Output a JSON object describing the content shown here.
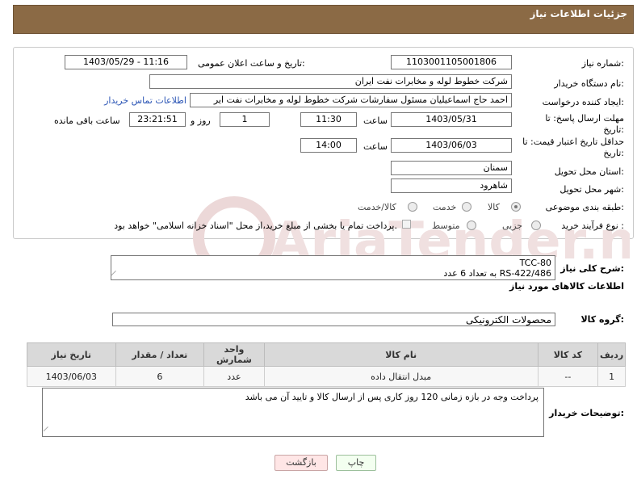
{
  "header": {
    "title": "جزئیات اطلاعات نیاز"
  },
  "form": {
    "need_number_label": "شماره نیاز:",
    "need_number": "1103001105001806",
    "announce_label": "تاریخ و ساعت اعلان عمومی:",
    "announce_value": "1403/05/29 - 11:16",
    "buyer_org_label": "نام دستگاه خریدار:",
    "buyer_org": "شرکت خطوط لوله و مخابرات نفت ایران",
    "creator_label": "ایجاد کننده درخواست:",
    "creator": "احمد  حاج اسماعیلیان مسئول سفارشات  شرکت خطوط لوله و مخابرات نفت ایر",
    "contact_link": "اطلاعات تماس خریدار",
    "reply_deadline_label_1": "مهلت ارسال پاسخ: تا",
    "reply_deadline_label_2": "تاریخ:",
    "reply_date": "1403/05/31",
    "time_label": "ساعت",
    "reply_time": "11:30",
    "days": "1",
    "days_label": "روز و",
    "remaining_time": "23:21:51",
    "remaining_label": "ساعت باقی مانده",
    "price_validity_label_1": "حداقل تاریخ اعتبار قیمت: تا",
    "price_validity_label_2": "تاریخ:",
    "price_date": "1403/06/03",
    "price_time_label": "ساعت",
    "price_time": "14:00",
    "province_label": "استان محل تحویل:",
    "province": "سمنان",
    "city_label": "شهر محل تحویل:",
    "city": "شاهرود",
    "category_label": "طبقه بندی موضوعی:",
    "category_options": [
      "کالا",
      "خدمت",
      "کالا/خدمت"
    ],
    "purchase_type_label": "نوع فرآیند خرید :",
    "purchase_options": [
      "جزیی",
      "متوسط"
    ],
    "payment_note": "پرداخت تمام یا بخشی از مبلغ خرید،از محل \"اسناد خزانه اسلامی\" خواهد بود."
  },
  "summary": {
    "label": "شرح کلی نیاز:",
    "line1": "TCC-80",
    "line2": "RS-422/486 به تعداد 6 عدد"
  },
  "goods": {
    "section_title": "اطلاعات کالاهای مورد نیاز",
    "group_label": "گروه کالا:",
    "group_value": "محصولات الکترونیکی"
  },
  "table": {
    "headers": [
      "ردیف",
      "کد کالا",
      "نام کالا",
      "واحد شمارش",
      "تعداد / مقدار",
      "تاریخ نیاز"
    ],
    "rows": [
      [
        "1",
        "--",
        "مبدل انتقال داده",
        "عدد",
        "6",
        "1403/06/03"
      ]
    ]
  },
  "buyer_notes": {
    "label": "توضیحات خریدار:",
    "text": "پرداخت وجه در بازه زمانی 120 روز کاری پس از ارسال کالا و تایید آن می باشد"
  },
  "buttons": {
    "print": "چاپ",
    "back": "بازگشت"
  },
  "watermark": {
    "text": "AriaTender.neT"
  }
}
